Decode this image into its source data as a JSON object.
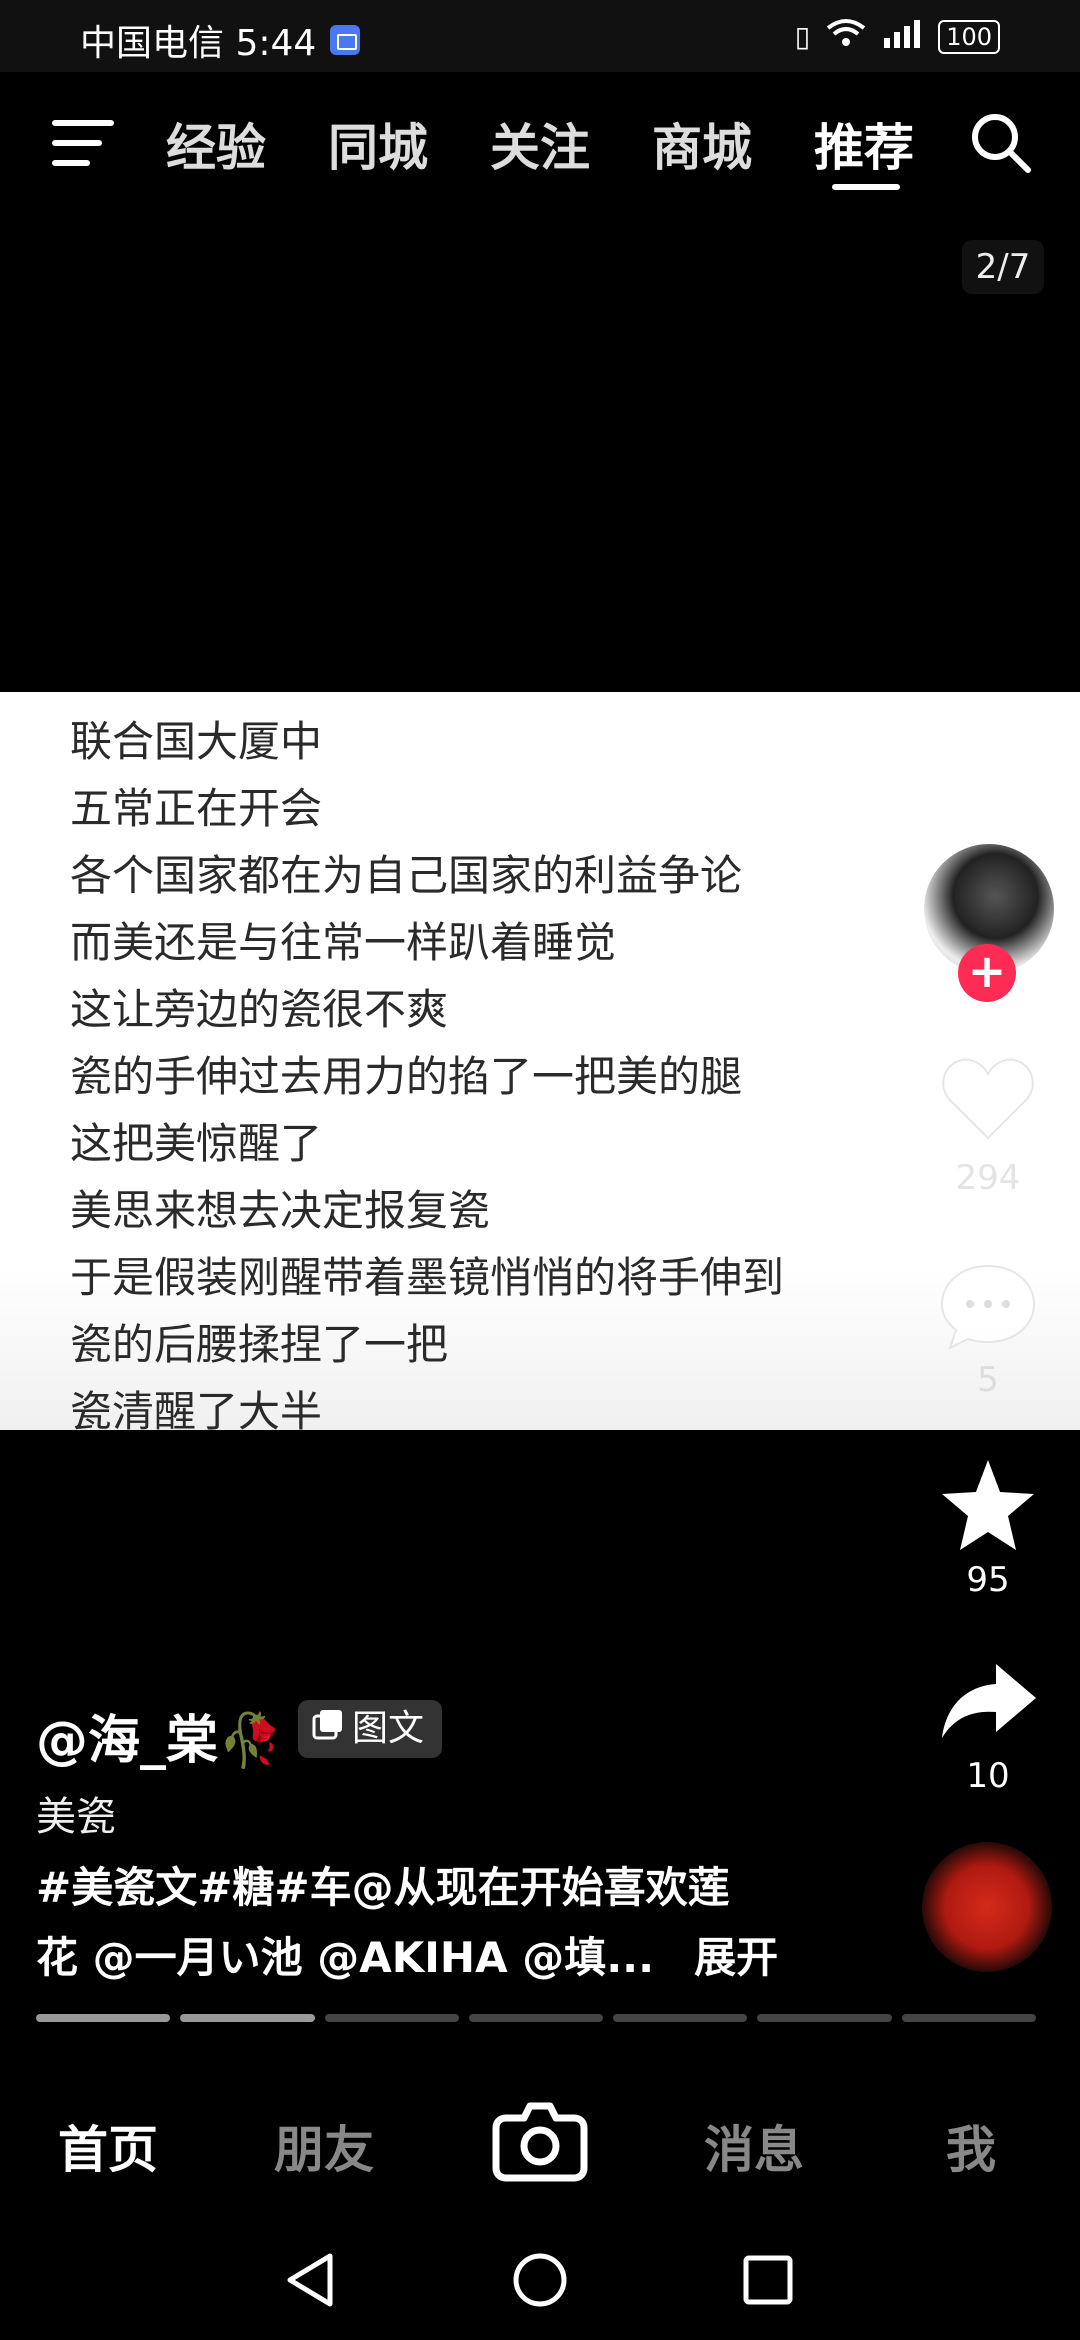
{
  "status_bar": {
    "carrier_time": "中国电信 5:44",
    "battery": "100"
  },
  "top_nav": {
    "tabs": [
      "经验",
      "同城",
      "关注",
      "商城",
      "推荐"
    ],
    "active_tab": "推荐"
  },
  "image_counter": "2/7",
  "post_text_lines": [
    "联合国大厦中",
    "五常正在开会",
    "各个国家都在为自己国家的利益争论",
    "而美还是与往常一样趴着睡觉",
    "这让旁边的瓷很不爽",
    "瓷的手伸过去用力的掐了一把美的腿",
    "这把美惊醒了",
    "美思来想去决定报复瓷",
    "于是假装刚醒带着墨镜悄悄的将手伸到",
    "瓷的后腰揉捏了一把",
    "瓷清醒了大半"
  ],
  "right_rail": {
    "likes": "294",
    "comments": "5",
    "favorites": "95",
    "shares": "10"
  },
  "caption": {
    "author": "@海_棠🥀",
    "post_type": "图文",
    "title": "美瓷",
    "line2": "#美瓷文#糖#车@从现在开始喜欢莲",
    "line3": "花 @一月い池 @AKIHA @填...",
    "expand": "展开"
  },
  "bottom_nav": {
    "home": "首页",
    "friends": "朋友",
    "messages": "消息",
    "me": "我"
  },
  "progress": {
    "total": 7,
    "current": 2
  }
}
